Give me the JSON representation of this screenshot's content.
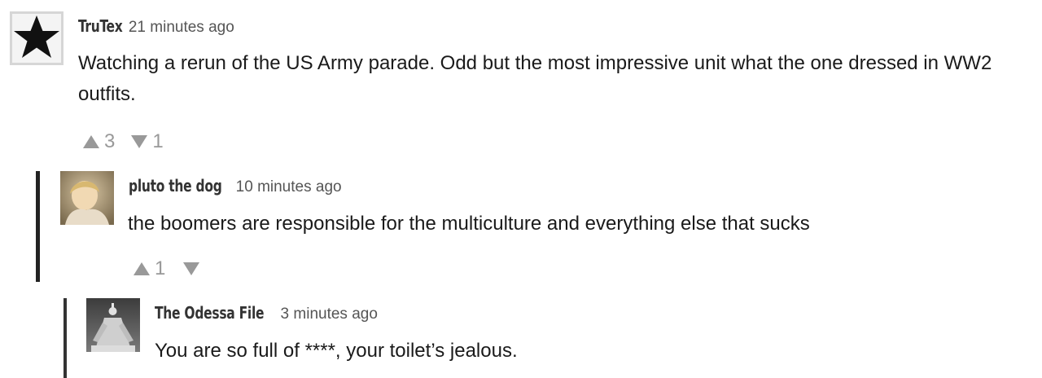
{
  "comments": [
    {
      "author": "TruTex",
      "time": "21 minutes ago",
      "text": "Watching a rerun of the US Army parade.  Odd but the most impressive unit what the one dressed in WW2 outfits.",
      "upvotes": "3",
      "downvotes": "1",
      "avatar_icon": "star-icon"
    },
    {
      "author": "pluto the dog",
      "time": "10 minutes ago",
      "text": "the boomers are responsible for the multiculture and everything else that sucks",
      "upvotes": "1",
      "downvotes": "",
      "avatar_icon": "portrait-avatar"
    },
    {
      "author": "The Odessa File",
      "time": "3 minutes ago",
      "text": "You are so full of ****, your toilet’s jealous.",
      "avatar_icon": "statue-avatar"
    }
  ],
  "colors": {
    "vote": "#999999",
    "thread_bar": "#222222",
    "author": "#333333"
  }
}
